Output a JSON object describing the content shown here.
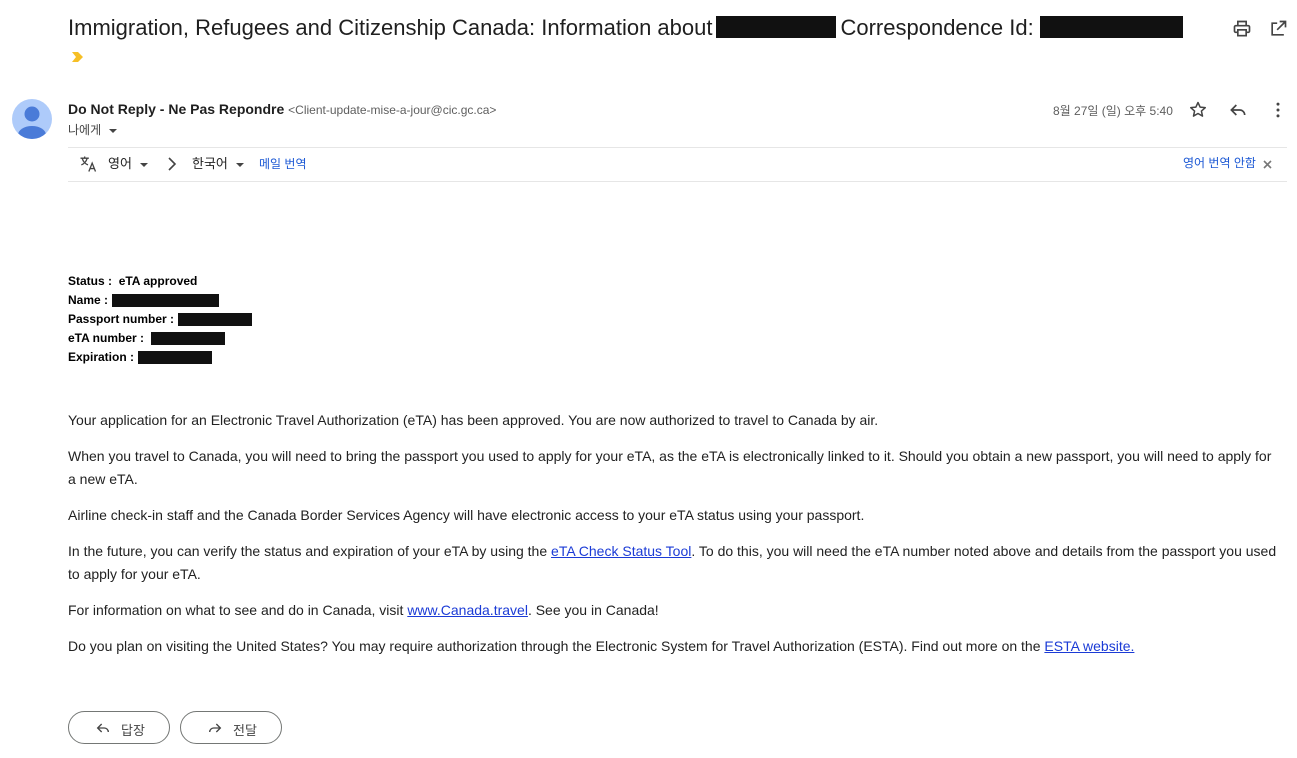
{
  "subject": {
    "title_prefix": "Immigration, Refugees and Citizenship Canada: Information about",
    "title_middle": "Correspondence Id:"
  },
  "toolbar": {
    "print_icon": "print-icon",
    "open_new_window_icon": "open-in-new-window-icon"
  },
  "sender": {
    "name": "Do Not Reply - Ne Pas Repondre",
    "email": "<Client-update-mise-a-jour@cic.gc.ca>",
    "to_label": "나에게",
    "date": "8월 27일 (일) 오후 5:40"
  },
  "translate": {
    "source_language": "영어",
    "target_language": "한국어",
    "translate_link": "메일 번역",
    "dont_translate": "영어 번역 안함"
  },
  "fields": {
    "status_label": "Status :",
    "status_value": "eTA approved",
    "name_label": "Name :",
    "passport_label": "Passport number :",
    "eta_label": "eTA number :",
    "expiration_label": "Expiration :"
  },
  "body": {
    "p1": "Your application for an Electronic Travel Authorization (eTA) has been approved. You are now authorized to travel to Canada by air.",
    "p2": "When you travel to Canada, you will need to bring the passport you used to apply for your eTA, as the eTA is electronically linked to it. Should you obtain a new passport, you will need to apply for a new eTA.",
    "p3": "Airline check-in staff and the Canada Border Services Agency will have electronic access to your eTA status using your passport.",
    "p4_pre": "In the future, you can verify the status and expiration of your eTA by using the ",
    "p4_link": "eTA Check Status Tool",
    "p4_post": ". To do this, you will need the eTA number noted above and details from the passport you used to apply for your eTA.",
    "p5_pre": "For information on what to see and do in Canada, visit ",
    "p5_link": "www.Canada.travel",
    "p5_post": ". See you in Canada!",
    "p6_pre": "Do you plan on visiting the United States? You may require authorization through the Electronic System for Travel Authorization (ESTA). Find out more on the ",
    "p6_link": "ESTA website."
  },
  "actions": {
    "reply": "답장",
    "forward": "전달"
  },
  "colors": {
    "link": "#1b3bd6",
    "accent_blue": "#1a57d4",
    "importance": "#f6bf26"
  }
}
